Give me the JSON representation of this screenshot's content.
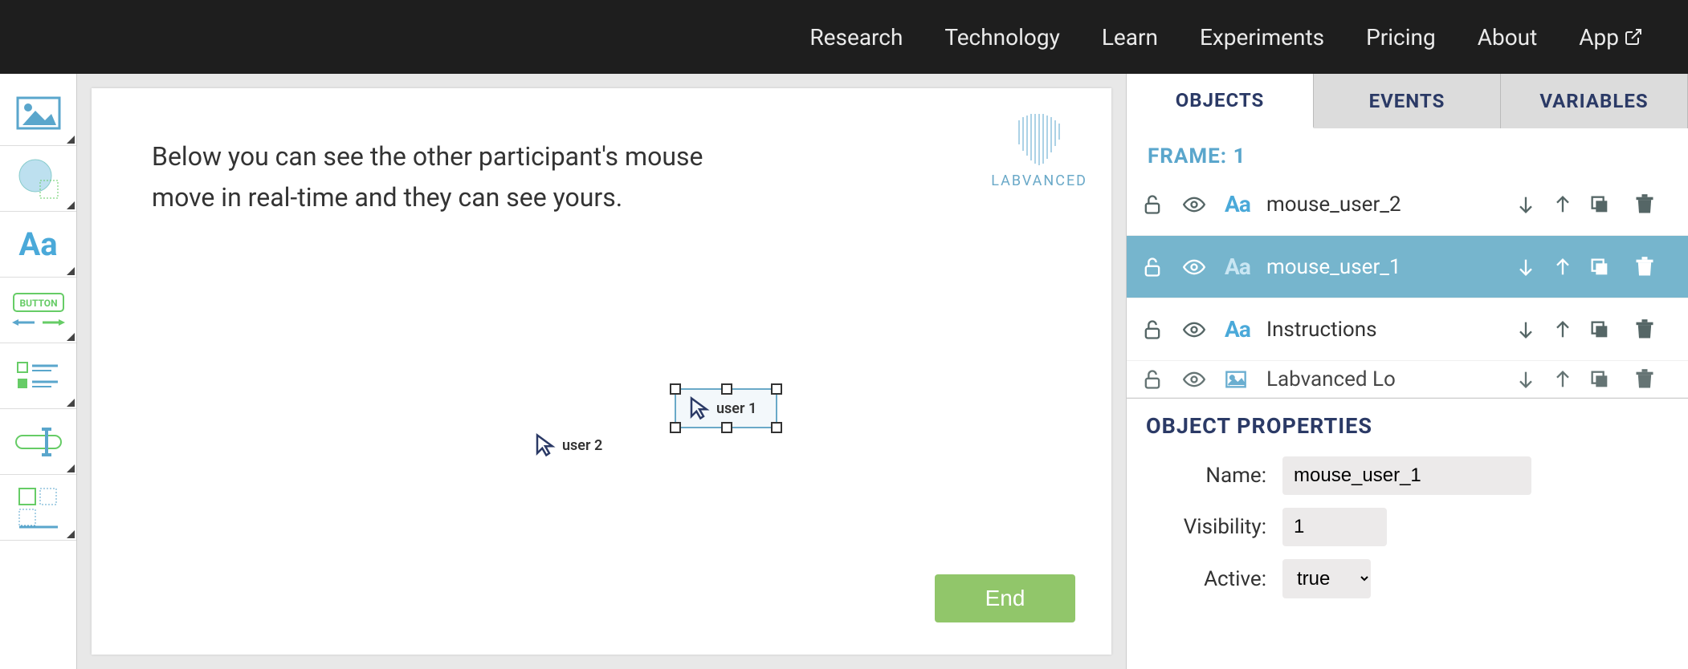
{
  "nav": {
    "items": [
      "Research",
      "Technology",
      "Learn",
      "Experiments",
      "Pricing",
      "About",
      "App"
    ]
  },
  "canvas": {
    "instructions": "Below you can see the other participant's mouse move in real-time and they can see yours.",
    "logo_text": "LABVANCED",
    "cursor1_label": "user 1",
    "cursor2_label": "user 2",
    "end_button": "End"
  },
  "tabs": {
    "objects": "OBJECTS",
    "events": "EVENTS",
    "variables": "VARIABLES"
  },
  "frame_label": "FRAME: 1",
  "objects": [
    {
      "name": "mouse_user_2",
      "type": "text",
      "type_label": "Aa",
      "selected": false
    },
    {
      "name": "mouse_user_1",
      "type": "text",
      "type_label": "Aa",
      "selected": true
    },
    {
      "name": "Instructions",
      "type": "text",
      "type_label": "Aa",
      "selected": false
    },
    {
      "name": "Labvanced Lo",
      "type": "image",
      "type_label": "",
      "selected": false
    }
  ],
  "properties": {
    "header": "OBJECT PROPERTIES",
    "name_label": "Name:",
    "name_value": "mouse_user_1",
    "visibility_label": "Visibility:",
    "visibility_value": "1",
    "active_label": "Active:",
    "active_value": "true"
  }
}
